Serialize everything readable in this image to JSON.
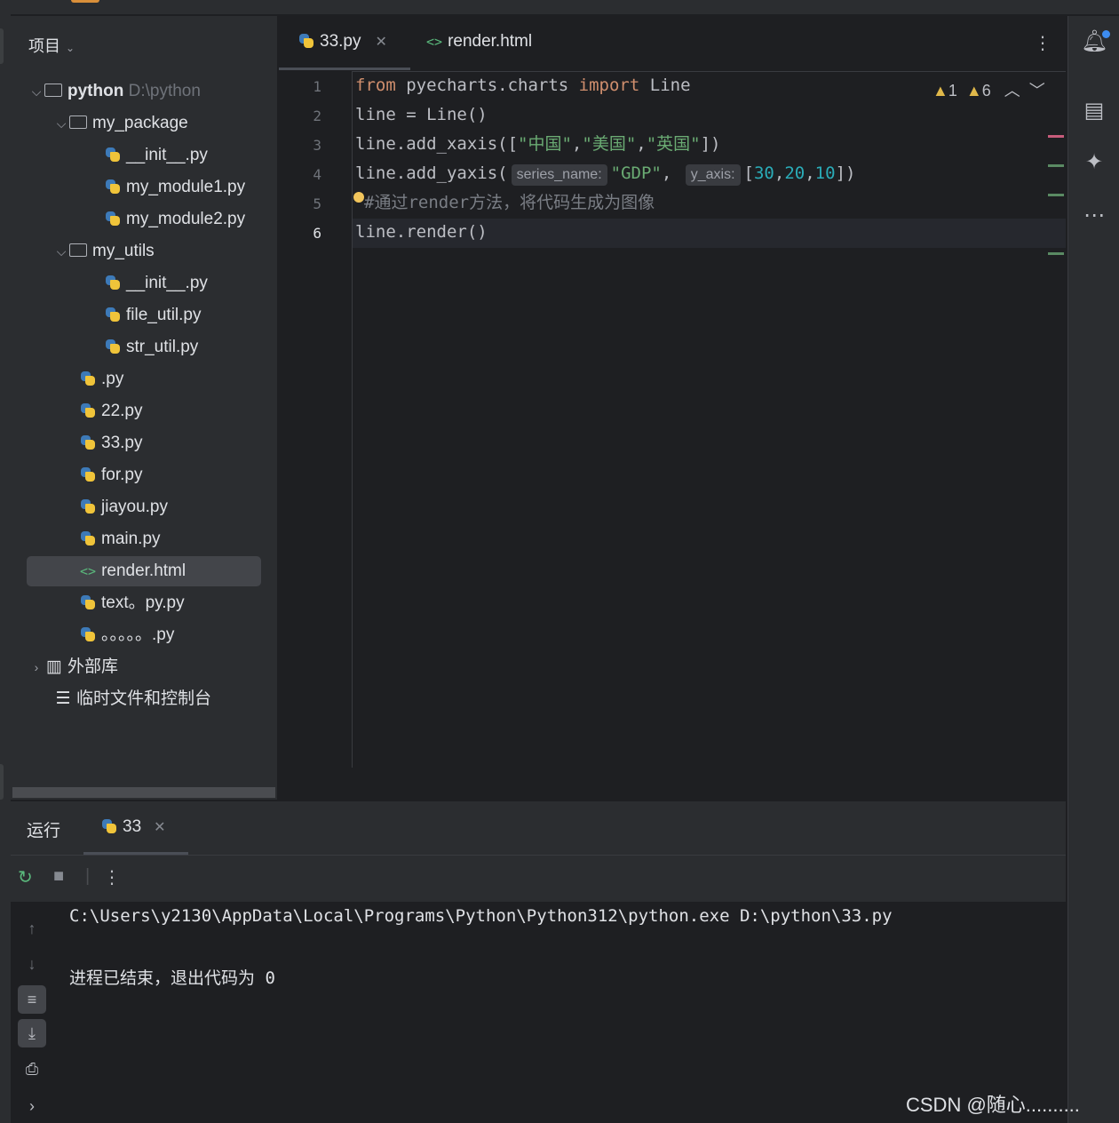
{
  "project_panel": {
    "title": "项目",
    "root": {
      "name": "python",
      "path": "D:\\python"
    },
    "items": [
      {
        "label": "my_package",
        "type": "folder"
      },
      {
        "label": "__init__.py",
        "type": "py"
      },
      {
        "label": "my_module1.py",
        "type": "py"
      },
      {
        "label": "my_module2.py",
        "type": "py"
      },
      {
        "label": "my_utils",
        "type": "folder"
      },
      {
        "label": "__init__.py",
        "type": "py"
      },
      {
        "label": "file_util.py",
        "type": "py"
      },
      {
        "label": "str_util.py",
        "type": "py"
      },
      {
        "label": ".py",
        "type": "py"
      },
      {
        "label": "22.py",
        "type": "py"
      },
      {
        "label": "33.py",
        "type": "py"
      },
      {
        "label": "for.py",
        "type": "py"
      },
      {
        "label": "jiayou.py",
        "type": "py"
      },
      {
        "label": "main.py",
        "type": "py"
      },
      {
        "label": "render.html",
        "type": "html",
        "selected": true
      },
      {
        "label": "text。py.py",
        "type": "py"
      },
      {
        "label": "。。。。。.py",
        "type": "py"
      }
    ],
    "external_libs": "外部库",
    "scratches": "临时文件和控制台"
  },
  "editor": {
    "tabs": [
      {
        "label": "33.py",
        "active": true
      },
      {
        "label": "render.html",
        "active": false
      }
    ],
    "warnings": {
      "count_a": "1",
      "count_b": "6"
    },
    "lines": [
      "1",
      "2",
      "3",
      "4",
      "5",
      "6"
    ],
    "code": {
      "l1_from": "from",
      "l1_mod": " pyecharts.charts ",
      "l1_import": "import",
      "l1_name": " Line",
      "l2": "line = Line()",
      "l3_a": "line.add_xaxis([",
      "l3_s1": "\"中国\"",
      "l3_s2": "\"美国\"",
      "l3_s3": "\"英国\"",
      "l3_end": "])",
      "l4_a": "line.add_yaxis(",
      "l4_hint1": "series_name:",
      "l4_s": "\"GDP\"",
      "l4_hint2": "y_axis:",
      "l4_n1": "30",
      "l4_n2": "20",
      "l4_n3": "10",
      "l5": "#通过render方法，将代码生成为图像",
      "l6": "line.render()"
    }
  },
  "run_panel": {
    "title": "运行",
    "tab": "33",
    "output_line1": "C:\\Users\\y2130\\AppData\\Local\\Programs\\Python\\Python312\\python.exe D:\\python\\33.py",
    "output_line2": "进程已结束，退出代码为 0"
  },
  "watermark": "CSDN @随心..........",
  "colors": {
    "keyword": "#cf8e6d",
    "string": "#6aab73",
    "number": "#2aacb8",
    "comment": "#7a7e85"
  }
}
